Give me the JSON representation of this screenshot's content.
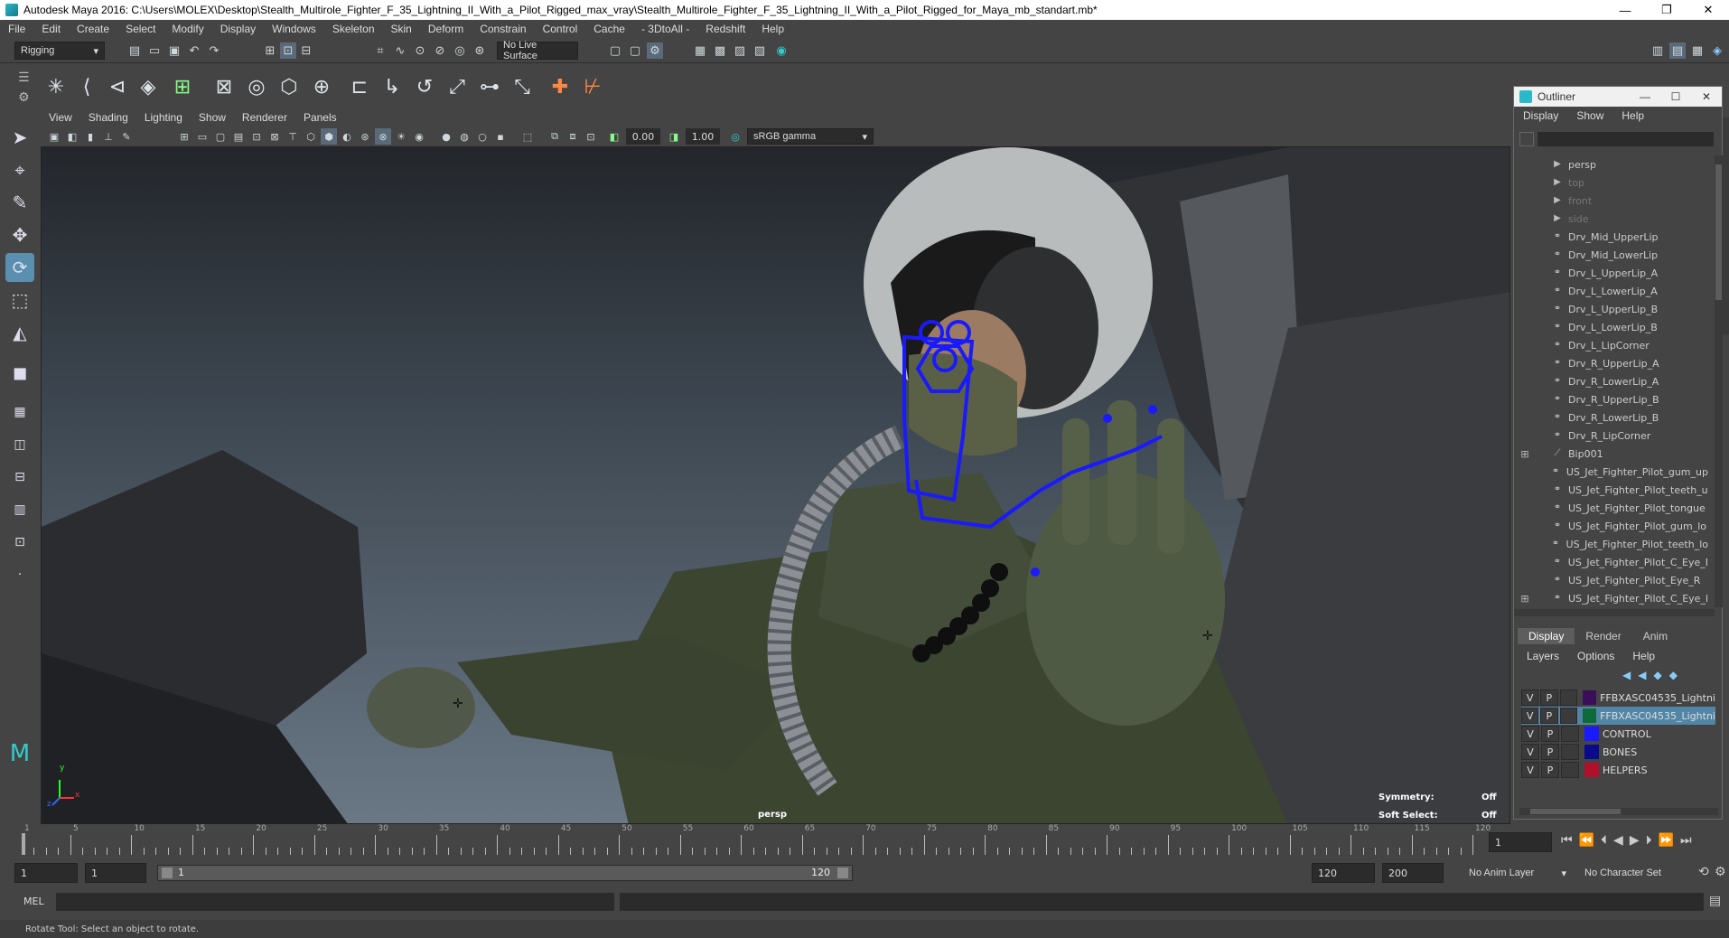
{
  "window": {
    "title": "Autodesk Maya 2016: C:\\Users\\MOLEX\\Desktop\\Stealth_Multirole_Fighter_F_35_Lightning_II_With_a_Pilot_Rigged_max_vray\\Stealth_Multirole_Fighter_F_35_Lightning_II_With_a_Pilot_Rigged_for_Maya_mb_standart.mb*",
    "minimize": "—",
    "restore": "❐",
    "close": "✕"
  },
  "menubar": [
    "File",
    "Edit",
    "Create",
    "Select",
    "Modify",
    "Display",
    "Windows",
    "Skeleton",
    "Skin",
    "Deform",
    "Constrain",
    "Control",
    "Cache",
    "- 3DtoAll -",
    "Redshift",
    "Help"
  ],
  "status_line": {
    "menu_set": "Rigging",
    "live_surface": "No Live Surface"
  },
  "panel_menu": [
    "View",
    "Shading",
    "Lighting",
    "Show",
    "Renderer",
    "Panels"
  ],
  "panel_toolbar": {
    "near": "0.00",
    "far": "1.00",
    "color_space": "sRGB gamma"
  },
  "viewport": {
    "camera": "persp",
    "axis_y": "y",
    "axis_z": "z",
    "axis_x": "x",
    "hud": {
      "symmetry_label": "Symmetry:",
      "symmetry_value": "Off",
      "soft_select_label": "Soft Select:",
      "soft_select_value": "Off"
    }
  },
  "outliner": {
    "title": "Outliner",
    "menu": [
      "Display",
      "Show",
      "Help"
    ],
    "items": [
      {
        "label": "persp",
        "type": "camera"
      },
      {
        "label": "top",
        "type": "camera",
        "dim": true
      },
      {
        "label": "front",
        "type": "camera",
        "dim": true
      },
      {
        "label": "side",
        "type": "camera",
        "dim": true
      },
      {
        "label": "Drv_Mid_UpperLip",
        "type": "joint"
      },
      {
        "label": "Drv_Mid_LowerLip",
        "type": "joint"
      },
      {
        "label": "Drv_L_UpperLip_A",
        "type": "joint"
      },
      {
        "label": "Drv_L_LowerLip_A",
        "type": "joint"
      },
      {
        "label": "Drv_L_UpperLip_B",
        "type": "joint"
      },
      {
        "label": "Drv_L_LowerLip_B",
        "type": "joint"
      },
      {
        "label": "Drv_L_LipCorner",
        "type": "joint"
      },
      {
        "label": "Drv_R_UpperLip_A",
        "type": "joint"
      },
      {
        "label": "Drv_R_LowerLip_A",
        "type": "joint"
      },
      {
        "label": "Drv_R_UpperLip_B",
        "type": "joint"
      },
      {
        "label": "Drv_R_LowerLip_B",
        "type": "joint"
      },
      {
        "label": "Drv_R_LipCorner",
        "type": "joint"
      },
      {
        "label": "Bip001",
        "type": "bone",
        "expand": true
      },
      {
        "label": "US_Jet_Fighter_Pilot_gum_up",
        "type": "mesh"
      },
      {
        "label": "US_Jet_Fighter_Pilot_teeth_u",
        "type": "mesh"
      },
      {
        "label": "US_Jet_Fighter_Pilot_tongue",
        "type": "mesh"
      },
      {
        "label": "US_Jet_Fighter_Pilot_gum_lo",
        "type": "mesh"
      },
      {
        "label": "US_Jet_Fighter_Pilot_teeth_lo",
        "type": "mesh"
      },
      {
        "label": "US_Jet_Fighter_Pilot_C_Eye_I",
        "type": "mesh"
      },
      {
        "label": "US_Jet_Fighter_Pilot_Eye_R",
        "type": "mesh"
      },
      {
        "label": "US_Jet_Fighter_Pilot_C_Eye_l",
        "type": "mesh",
        "expand": true
      }
    ]
  },
  "layer_editor": {
    "tabs": [
      "Display",
      "Render",
      "Anim"
    ],
    "menu": [
      "Layers",
      "Options",
      "Help"
    ],
    "layers": [
      {
        "v": "V",
        "p": "P",
        "name": "FFBXASC04535_Lightni",
        "color": "#3a0f5a"
      },
      {
        "v": "V",
        "p": "P",
        "name": "FFBXASC04535_Lightni",
        "color": "#0f6a3a",
        "selected": true
      },
      {
        "v": "V",
        "p": "P",
        "name": "CONTROL",
        "color": "#1a1aff"
      },
      {
        "v": "V",
        "p": "P",
        "name": "BONES",
        "color": "#0a0a8a"
      },
      {
        "v": "V",
        "p": "P",
        "name": "HELPERS",
        "color": "#b0102a"
      }
    ]
  },
  "timeline": {
    "ticks": [
      "1",
      "5",
      "10",
      "15",
      "20",
      "25",
      "30",
      "35",
      "40",
      "45",
      "50",
      "55",
      "60",
      "65",
      "70",
      "75",
      "80",
      "85",
      "90",
      "95",
      "100",
      "105",
      "110",
      "115",
      "120"
    ],
    "current_frame": "1"
  },
  "range": {
    "start": "1",
    "playback_start": "1",
    "range_start": "1",
    "range_end": "120",
    "playback_end": "120",
    "end": "200",
    "anim_layer": "No Anim Layer",
    "character_set": "No Character Set"
  },
  "cmd": {
    "label": "MEL"
  },
  "help_line": "Rotate Tool: Select an object to rotate."
}
